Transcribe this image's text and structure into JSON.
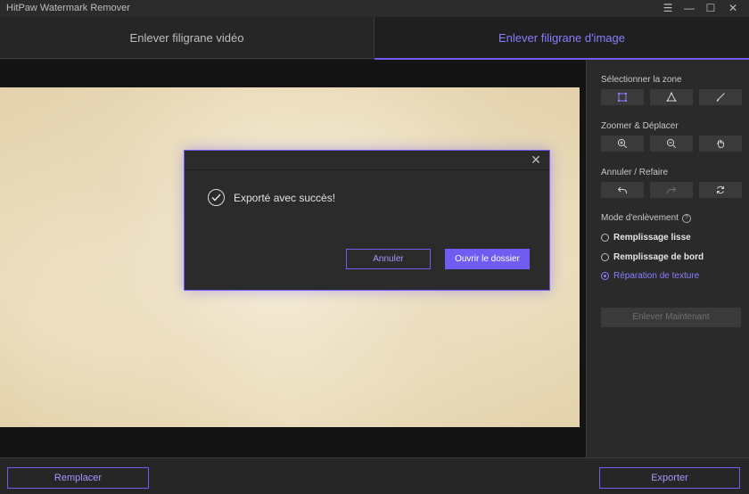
{
  "window": {
    "title": "HitPaw Watermark Remover",
    "controls": {
      "menu": "☰",
      "minimize": "—",
      "maximize": "☐",
      "close": "✕"
    }
  },
  "tabs": [
    {
      "label": "Enlever filigrane vidéo",
      "active": false
    },
    {
      "label": "Enlever filigrane d'image",
      "active": true
    }
  ],
  "side_panel": {
    "select_zone": {
      "label": "Sélectionner la zone",
      "tools": [
        "rectangle-select-icon",
        "polygon-lasso-icon",
        "brush-icon"
      ]
    },
    "zoom_move": {
      "label": "Zoomer & Déplacer",
      "tools": [
        "zoom-in-icon",
        "zoom-out-icon",
        "hand-pan-icon"
      ]
    },
    "undo_redo": {
      "label": "Annuler / Refaire",
      "tools": [
        "undo-icon",
        "redo-icon",
        "reset-icon"
      ]
    },
    "mode": {
      "label": "Mode d'enlèvement",
      "help": "?",
      "options": [
        {
          "label": "Remplissage lisse",
          "selected": false
        },
        {
          "label": "Remplissage de bord",
          "selected": false
        },
        {
          "label": "Réparation de texture",
          "selected": true
        }
      ]
    },
    "remove_now": "Enlever Maintenant"
  },
  "bottom": {
    "replace": "Remplacer",
    "export": "Exporter"
  },
  "dialog": {
    "close": "✕",
    "message": "Exporté avec succès!",
    "cancel": "Annuler",
    "open_folder": "Ouvrir le dossier"
  },
  "colors": {
    "accent": "#6f5cf0",
    "accent_text": "#8a7dff",
    "background": "#1e1e1e",
    "panel": "#2a2a2a"
  }
}
